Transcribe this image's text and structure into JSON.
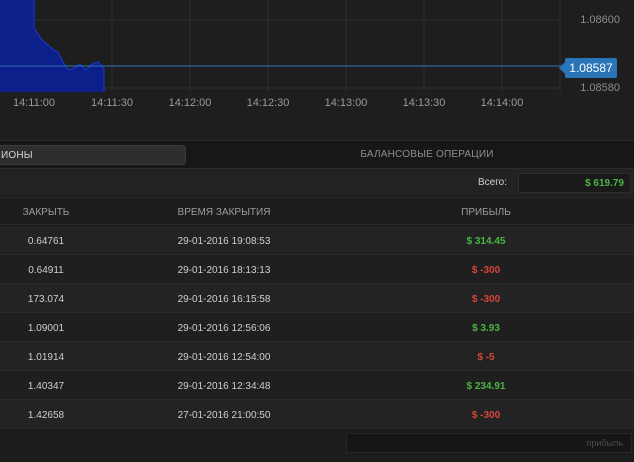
{
  "chart": {
    "price_labels": [
      "1.08600",
      "1.08580"
    ],
    "current_price": "1.08587",
    "time_labels": [
      "14:11:00",
      "14:11:30",
      "14:12:00",
      "14:12:30",
      "14:13:00",
      "14:13:30",
      "14:14:00"
    ],
    "area_color": "#0d1f8a",
    "line_color": "#2a74b8"
  },
  "tabs": {
    "positions_label": "ИОНЫ",
    "balance_label": "БАЛАНСОВЫЕ ОПЕРАЦИИ"
  },
  "total": {
    "label": "Всего:",
    "value": "$ 619.79"
  },
  "table": {
    "columns": {
      "close": "ЗАКРЫТЬ",
      "close_time": "ВРЕМЯ ЗАКРЫТИЯ",
      "profit": "ПРИБЫЛЬ"
    },
    "rows": [
      {
        "close": "0.64761",
        "time": "29-01-2016 19:08:53",
        "profit": "$ 314.45",
        "status": "pos"
      },
      {
        "close": "0.64911",
        "time": "29-01-2016 18:13:13",
        "profit": "$ -300",
        "status": "neg"
      },
      {
        "close": "173.074",
        "time": "29-01-2016 16:15:58",
        "profit": "$ -300",
        "status": "neg"
      },
      {
        "close": "1.09001",
        "time": "29-01-2016 12:56:06",
        "profit": "$ 3.93",
        "status": "pos"
      },
      {
        "close": "1.01914",
        "time": "29-01-2016 12:54:00",
        "profit": "$ -5",
        "status": "neg"
      },
      {
        "close": "1.40347",
        "time": "29-01-2016 12:34:48",
        "profit": "$ 234.91",
        "status": "pos"
      },
      {
        "close": "1.42658",
        "time": "27-01-2016 21:00:50",
        "profit": "$ -300",
        "status": "neg"
      }
    ]
  },
  "footer": {
    "profit_filter_placeholder": "прибыль"
  },
  "colors": {
    "positive": "#4bb543",
    "negative": "#d9443a",
    "accent": "#2a74b8"
  }
}
